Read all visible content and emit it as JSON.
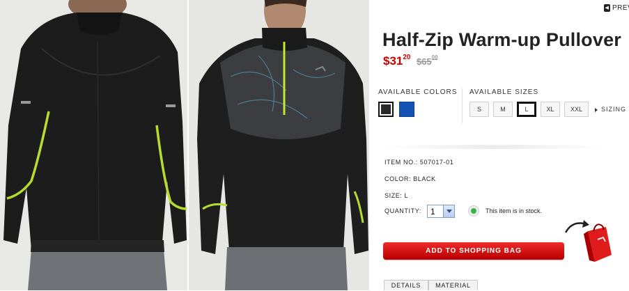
{
  "nav": {
    "prev_label": "PREV"
  },
  "product": {
    "title": "Half-Zip Warm-up Pullover",
    "price_now_main": "$31",
    "price_now_cents": "20",
    "price_was_main": "$65",
    "price_was_cents": "00"
  },
  "colors": {
    "label": "AVAILABLE COLORS",
    "swatches": [
      {
        "name": "Black",
        "hex": "#2a2a2a",
        "selected": true
      },
      {
        "name": "Blue",
        "hex": "#1351b4",
        "selected": false
      }
    ]
  },
  "sizes": {
    "label": "AVAILABLE SIZES",
    "options": [
      "S",
      "M",
      "L",
      "XL",
      "XXL"
    ],
    "selected": "L",
    "sizing_link": "SIZING C"
  },
  "details": {
    "item_no_label": "ITEM NO.:",
    "item_no": "507017-01",
    "color_label": "COLOR:",
    "color": "BLACK",
    "size_label": "SIZE:",
    "size": "L",
    "quantity_label": "QUANTITY:",
    "quantity": "1",
    "stock_text": "This item is in stock."
  },
  "cart": {
    "button_label": "ADD TO SHOPPING BAG"
  },
  "tabs": [
    "DETAILS",
    "MATERIAL"
  ],
  "brand_colors": {
    "accent_red": "#cc0000",
    "button_red": "#e01b1b",
    "stock_green": "#39b54a"
  }
}
